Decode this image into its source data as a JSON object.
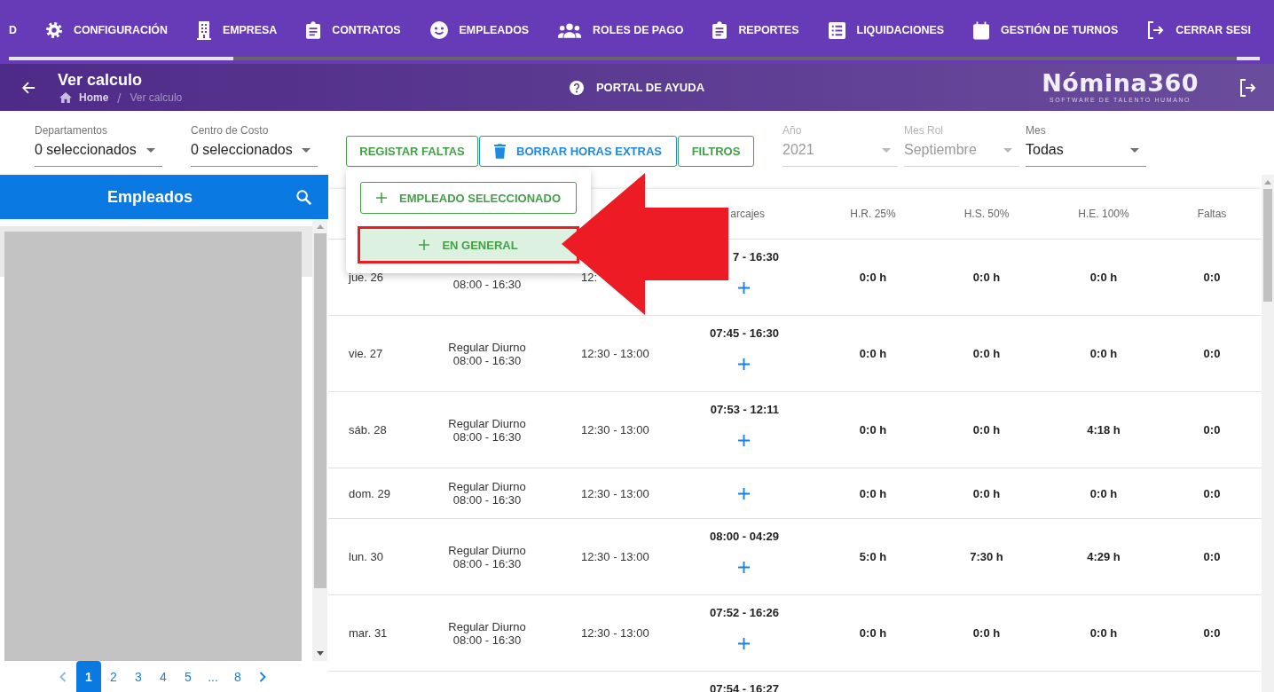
{
  "top_nav": {
    "items": [
      {
        "label": "D"
      },
      {
        "label": "CONFIGURACIÓN"
      },
      {
        "label": "EMPRESA"
      },
      {
        "label": "CONTRATOS"
      },
      {
        "label": "EMPLEADOS"
      },
      {
        "label": "ROLES DE PAGO"
      },
      {
        "label": "REPORTES"
      },
      {
        "label": "LIQUIDACIONES"
      },
      {
        "label": "GESTIÓN DE TURNOS"
      },
      {
        "label": "CERRAR SESI"
      }
    ]
  },
  "header": {
    "title": "Ver calculo",
    "breadcrumb": [
      {
        "label": "Home",
        "current": false
      },
      {
        "label": "Ver calculo",
        "current": true
      }
    ],
    "breadcrumb_separator": "/",
    "help_link": "PORTAL DE AYUDA",
    "logo": {
      "wordmark": "Nómina360",
      "tagline": "SOFTWARE DE TALENTO HUMANO"
    }
  },
  "toolbar": {
    "selects": [
      {
        "label": "Departamentos",
        "value": "0 seleccionados",
        "disabled": false
      },
      {
        "label": "Centro de Costo",
        "value": "0 seleccionados",
        "disabled": false
      }
    ],
    "buttons": [
      {
        "label": "REGISTAR FALTAS",
        "kind": "plain",
        "color": "#43a047"
      },
      {
        "label": "BORRAR HORAS EXTRAS",
        "kind": "delete",
        "color": "#1e88e5"
      },
      {
        "label": "FILTROS",
        "kind": "plain",
        "color": "#43a047"
      }
    ],
    "period_selects": [
      {
        "label": "Año",
        "value": "2021",
        "disabled": true
      },
      {
        "label": "Mes Rol",
        "value": "Septiembre",
        "disabled": true
      },
      {
        "label": "Mes",
        "value": "Todas",
        "disabled": false
      }
    ]
  },
  "dropdown_menu": {
    "items": [
      {
        "label": "EMPLEADO SELECCIONADO",
        "hovered": false,
        "annotated": false
      },
      {
        "label": "EN GENERAL",
        "hovered": true,
        "annotated": true
      }
    ]
  },
  "employees_panel": {
    "title": "Empleados",
    "pagination": {
      "pages": [
        {
          "label": "1",
          "selected": true
        },
        {
          "label": "2",
          "selected": false
        },
        {
          "label": "3",
          "selected": false
        },
        {
          "label": "4",
          "selected": false
        },
        {
          "label": "5",
          "selected": false
        },
        {
          "label": "...",
          "selected": false
        },
        {
          "label": "8",
          "selected": false
        }
      ]
    }
  },
  "table": {
    "columns": [
      {
        "label": "arcajes"
      },
      {
        "label": "H.R. 25%"
      },
      {
        "label": "H.S. 50%"
      },
      {
        "label": "H.E. 100%"
      },
      {
        "label": "Faltas"
      }
    ],
    "rows": [
      {
        "date": "jue. 26",
        "shift_hours": "08:00 - 16:30",
        "break": "12:",
        "punches": "7 - 16:30",
        "hr25": "0:0 h",
        "hs50": "0:0 h",
        "he100": "0:0 h",
        "absences": "0:0"
      },
      {
        "date": "vie. 27",
        "shift_name": "Regular Diurno",
        "shift_hours": "08:00 - 16:30",
        "break": "12:30 - 13:00",
        "punches": "07:45 - 16:30",
        "hr25": "0:0 h",
        "hs50": "0:0 h",
        "he100": "0:0 h",
        "absences": "0:0"
      },
      {
        "date": "sáb. 28",
        "shift_name": "Regular Diurno",
        "shift_hours": "08:00 - 16:30",
        "break": "12:30 - 13:00",
        "punches": "07:53 - 12:11",
        "hr25": "0:0 h",
        "hs50": "0:0 h",
        "he100": "4:18 h",
        "absences": "0:0"
      },
      {
        "date": "dom. 29",
        "shift_name": "Regular Diurno",
        "shift_hours": "08:00 - 16:30",
        "break": "12:30 - 13:00",
        "hr25": "0:0 h",
        "hs50": "0:0 h",
        "he100": "0:0 h",
        "absences": "0:0"
      },
      {
        "date": "lun. 30",
        "shift_name": "Regular Diurno",
        "shift_hours": "08:00 - 16:30",
        "break": "12:30 - 13:00",
        "punches": "08:00 - 04:29",
        "hr25": "5:0 h",
        "hs50": "7:30 h",
        "he100": "4:29 h",
        "absences": "0:0"
      },
      {
        "date": "mar. 31",
        "shift_name": "Regular Diurno",
        "shift_hours": "08:00 - 16:30",
        "break": "12:30 - 13:00",
        "punches": "07:52 - 16:26",
        "hr25": "0:0 h",
        "hs50": "0:0 h",
        "he100": "0:0 h",
        "absences": "0:0"
      }
    ],
    "cut_off_row": {
      "punches": "07:54 - 16:27"
    }
  }
}
